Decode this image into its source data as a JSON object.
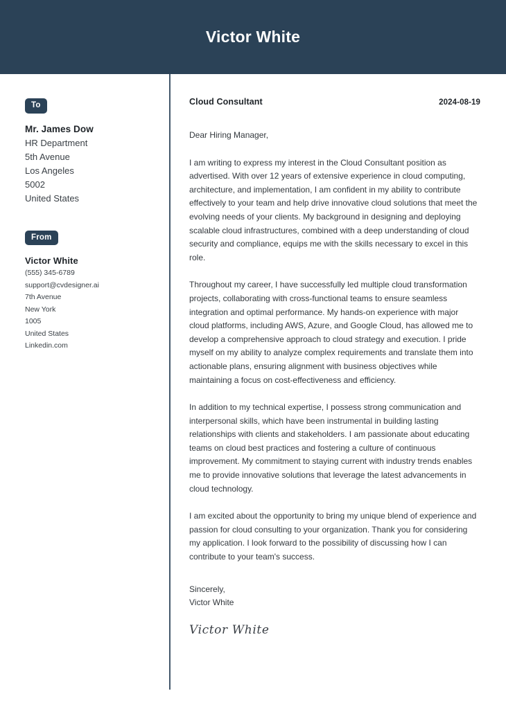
{
  "theme": {
    "accent_navy": "#2b4257",
    "divider": "#44586c",
    "body_text": "#33383d",
    "heading_text": "#1f2429",
    "page_background": "#ffffff"
  },
  "header": {
    "name": "Victor White"
  },
  "sidebar": {
    "to": {
      "badge_label": "To",
      "name": "Mr. James Dow",
      "lines": [
        "HR Department",
        "5th Avenue",
        "Los Angeles",
        "5002",
        "United States"
      ]
    },
    "from": {
      "badge_label": "From",
      "name": "Victor White",
      "lines": [
        "(555) 345-6789",
        "support@cvdesigner.ai",
        "7th Avenue",
        "New York",
        "1005",
        "United States",
        "Linkedin.com"
      ]
    }
  },
  "letter": {
    "job_title": "Cloud Consultant",
    "date": "2024-08-19",
    "salutation": "Dear Hiring Manager,",
    "paragraphs": [
      "I am writing to express my interest in the Cloud Consultant position as advertised. With over 12 years of extensive experience in cloud computing, architecture, and implementation, I am confident in my ability to contribute effectively to your team and help drive innovative cloud solutions that meet the evolving needs of your clients. My background in designing and deploying scalable cloud infrastructures, combined with a deep understanding of cloud security and compliance, equips me with the skills necessary to excel in this role.",
      "Throughout my career, I have successfully led multiple cloud transformation projects, collaborating with cross-functional teams to ensure seamless integration and optimal performance. My hands-on experience with major cloud platforms, including AWS, Azure, and Google Cloud, has allowed me to develop a comprehensive approach to cloud strategy and execution. I pride myself on my ability to analyze complex requirements and translate them into actionable plans, ensuring alignment with business objectives while maintaining a focus on cost-effectiveness and efficiency.",
      "In addition to my technical expertise, I possess strong communication and interpersonal skills, which have been instrumental in building lasting relationships with clients and stakeholders. I am passionate about educating teams on cloud best practices and fostering a culture of continuous improvement. My commitment to staying current with industry trends enables me to provide innovative solutions that leverage the latest advancements in cloud technology.",
      "I am excited about the opportunity to bring my unique blend of experience and passion for cloud consulting to your organization. Thank you for considering my application. I look forward to the possibility of discussing how I can contribute to your team's success."
    ],
    "closing_phrase": "Sincerely,",
    "closing_name": "Victor White",
    "signature": "Victor White"
  }
}
